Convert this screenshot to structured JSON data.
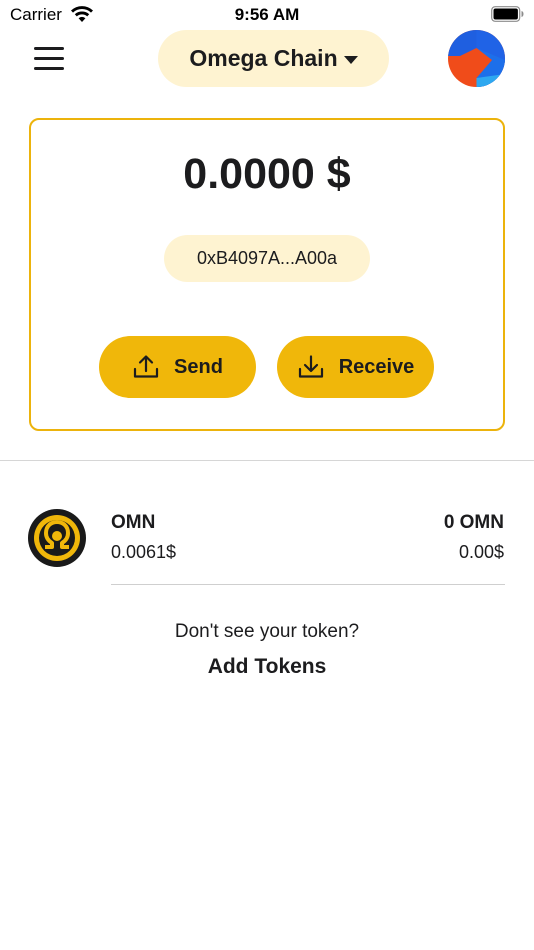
{
  "status_bar": {
    "carrier": "Carrier",
    "time": "9:56 AM"
  },
  "header": {
    "network_label": "Omega Chain",
    "menu_icon": "hamburger-menu-icon",
    "avatar_icon": "account-avatar-icon"
  },
  "wallet": {
    "balance": "0.0000 $",
    "address": "0xB4097A...A00a",
    "send_label": "Send",
    "receive_label": "Receive"
  },
  "tokens": [
    {
      "symbol": "OMN",
      "price": "0.0061$",
      "balance": "0 OMN",
      "value": "0.00$",
      "icon": "omega-token-icon"
    }
  ],
  "footer": {
    "prompt": "Don't see your token?",
    "add_tokens_label": "Add Tokens"
  },
  "colors": {
    "accent": "#f0b70a",
    "accent_light": "#fef3d1",
    "card_border": "#ecb30c",
    "text": "#1c1c1e"
  }
}
